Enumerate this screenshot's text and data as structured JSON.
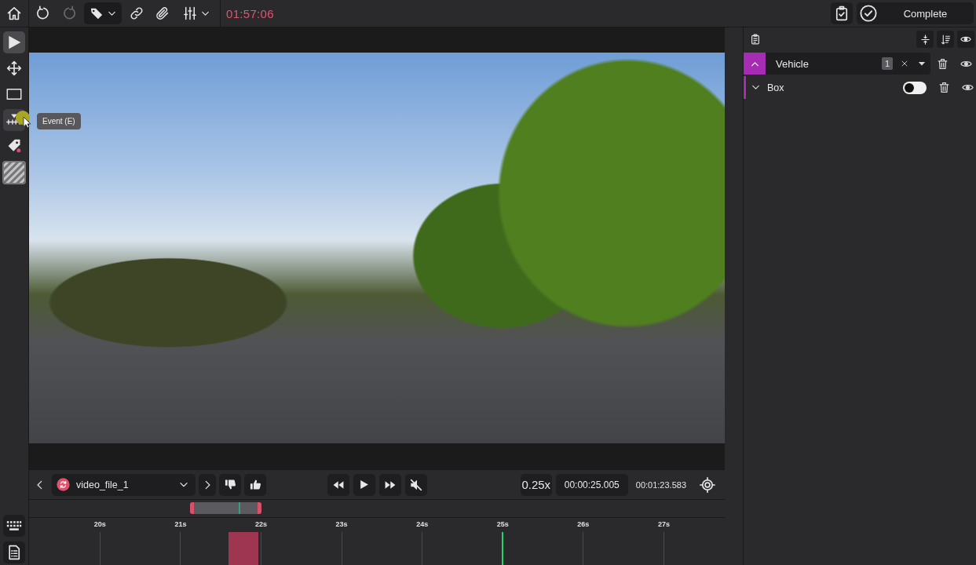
{
  "top_bar": {
    "history": [
      {
        "disabled": false
      },
      {
        "disabled": true
      }
    ],
    "label_menu": {
      "selected": true
    },
    "timer": "01:57:06",
    "complete_button": "Complete"
  },
  "tools": [
    {
      "selected": true,
      "hovered": false
    },
    {
      "selected": false,
      "hovered": false
    },
    {
      "selected": false,
      "hovered": false
    },
    {
      "selected": false,
      "hovered": true
    },
    {
      "selected": false,
      "hovered": false
    },
    {
      "selected": false,
      "hovered": false
    }
  ],
  "tooltip": "Event (E)",
  "classes": [
    {
      "name": "Vehicle",
      "color": "#a52cb3",
      "expanded": true,
      "count": "1",
      "children": [
        {
          "name": "Box",
          "expanded": false,
          "on": false
        }
      ]
    }
  ],
  "player": {
    "file": "video_file_1",
    "muted": true,
    "speed": "0.25x",
    "current_time": "00:00:25.005",
    "duration": "00:01:23.583"
  },
  "timeline": {
    "ticks": [
      "20s",
      "21s",
      "22s",
      "23s",
      "24s",
      "25s",
      "26s",
      "27s"
    ],
    "level": 0.681
  }
}
